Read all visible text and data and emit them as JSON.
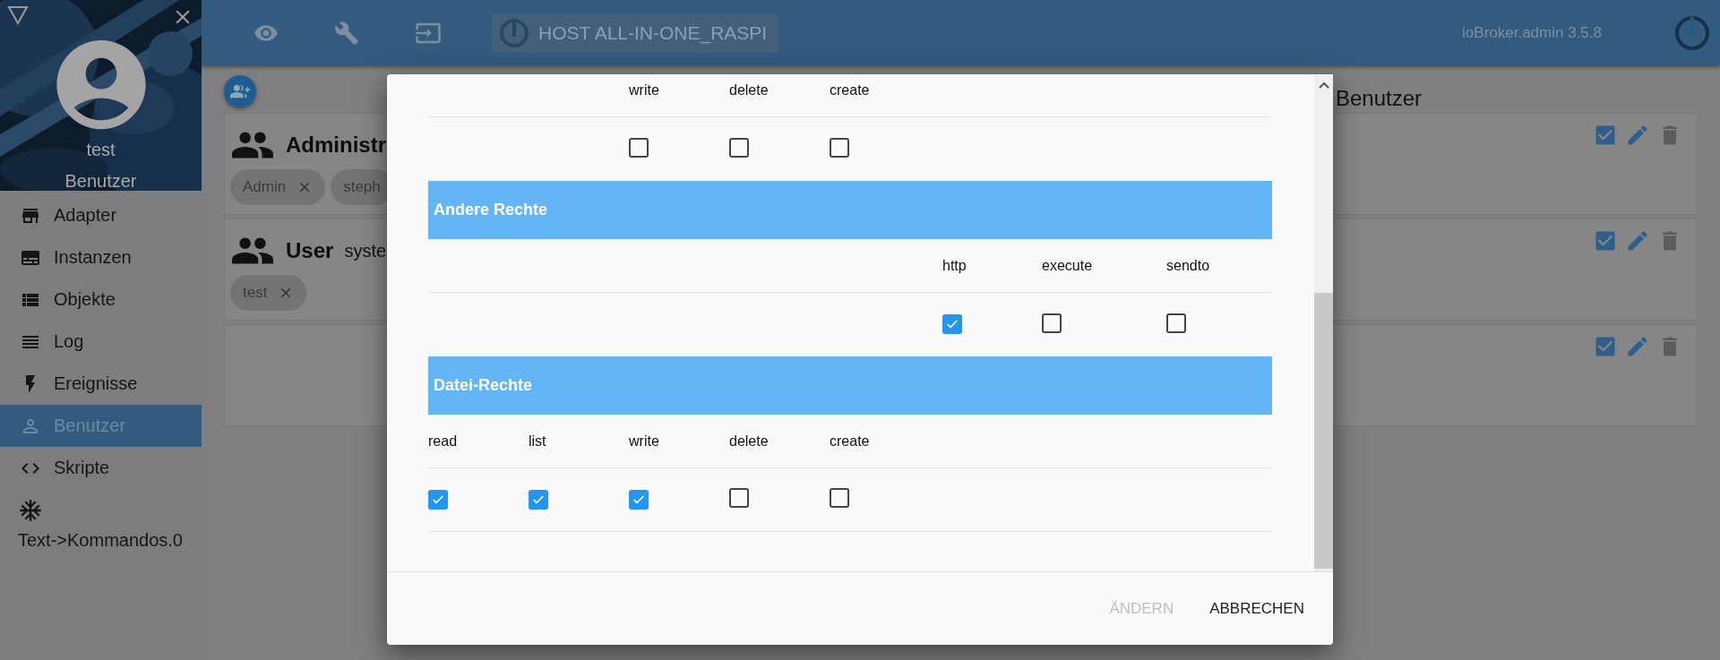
{
  "sidebar": {
    "header": {
      "user_name": "test",
      "user_group": "Benutzer"
    },
    "items": [
      {
        "label": "Adapter",
        "kind": "page",
        "selected": false
      },
      {
        "label": "Instanzen",
        "kind": "page",
        "selected": false
      },
      {
        "label": "Objekte",
        "kind": "page",
        "selected": false
      },
      {
        "label": "Log",
        "kind": "page",
        "selected": false
      },
      {
        "label": "Ereignisse",
        "kind": "page",
        "selected": false
      },
      {
        "label": "Benutzer",
        "kind": "page",
        "selected": true
      },
      {
        "label": "Skripte",
        "kind": "page",
        "selected": false
      },
      {
        "label": "Text->Kommandos.0",
        "kind": "adapter",
        "selected": false
      }
    ]
  },
  "top_bar": {
    "host": "HOST ALL-IN-ONE_RASPI",
    "version": "ioBroker.admin 3.5.8"
  },
  "users_heading": "Benutzer",
  "cards": [
    {
      "title": "Administr",
      "members": [
        {
          "name": "Admin",
          "remove_button": true
        },
        {
          "name": "steph",
          "remove_button": false
        }
      ],
      "enabled": true
    },
    {
      "title": "User",
      "description": "syste",
      "members": [
        {
          "name": "test",
          "remove_button": true
        }
      ],
      "enabled": true
    },
    {
      "enabled": true
    }
  ],
  "dialog": {
    "sections": [
      {
        "kind": "object",
        "permissions": [
          {
            "label": "write",
            "checked": false
          },
          {
            "label": "delete",
            "checked": false
          },
          {
            "label": "create",
            "checked": false
          }
        ]
      },
      {
        "kind": "other",
        "title": "Andere Rechte",
        "permissions": [
          {
            "label": "http",
            "checked": true
          },
          {
            "label": "execute",
            "checked": false
          },
          {
            "label": "sendto",
            "checked": false
          }
        ]
      },
      {
        "kind": "file",
        "title": "Datei-Rechte",
        "permissions": [
          {
            "label": "read",
            "checked": true
          },
          {
            "label": "list",
            "checked": true
          },
          {
            "label": "write",
            "checked": true
          },
          {
            "label": "delete",
            "checked": false
          },
          {
            "label": "create",
            "checked": false
          }
        ]
      }
    ],
    "buttons": [
      {
        "label": "ÄNDERN",
        "disabled": true
      },
      {
        "label": "ABBRECHEN",
        "disabled": false
      }
    ]
  }
}
